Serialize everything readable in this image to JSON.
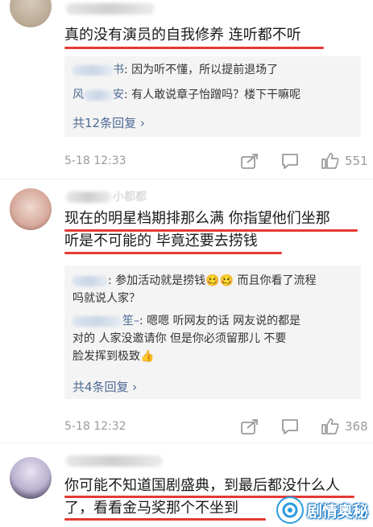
{
  "comments": [
    {
      "text": "真的没有演员的自我修养  连听都不听",
      "replies": [
        {
          "name_suffix": "书",
          "text": ": 因为听不懂，所以提前退场了"
        },
        {
          "name_prefix": "风",
          "name_suffix": "安",
          "text": ": 有人敢说章子怡蹭吗？楼下干嘛呢"
        }
      ],
      "more_replies": "共12条回复 ›",
      "time": "5-18 12:33",
      "likes": "551"
    },
    {
      "text_line1": "现在的明星档期排那么满 你指望他们坐那",
      "text_line2": "听是不可能的 毕竟还要去捞钱",
      "name_suffix": "小都都",
      "replies": [
        {
          "text_line1": ": 参加活动就是捞钱🥴🥴 而且你看了流程",
          "text_line2": "吗就说人家？"
        },
        {
          "name_suffix": "笙–",
          "text_line1": ": 嗯嗯  听网友的话  网友说的都是",
          "text_line2": "对的  人家没邀请你  但是你必须留那儿  不要",
          "text_line3": "脸发挥到极致👍"
        }
      ],
      "more_replies": "共4条回复 ›",
      "time": "5-18 12:32",
      "likes": "368"
    },
    {
      "text_line1": "你可能不知道国剧盛典，到最后都没什么人",
      "text_line2": "了，看看金马奖那个不坐到"
    }
  ],
  "watermark": {
    "label": "剧情奥秘"
  },
  "colors": {
    "underline": "#e53935",
    "link": "#4d6b94",
    "meta": "#9a9a9a"
  },
  "icons": [
    "share-icon",
    "comment-icon",
    "like-icon"
  ]
}
